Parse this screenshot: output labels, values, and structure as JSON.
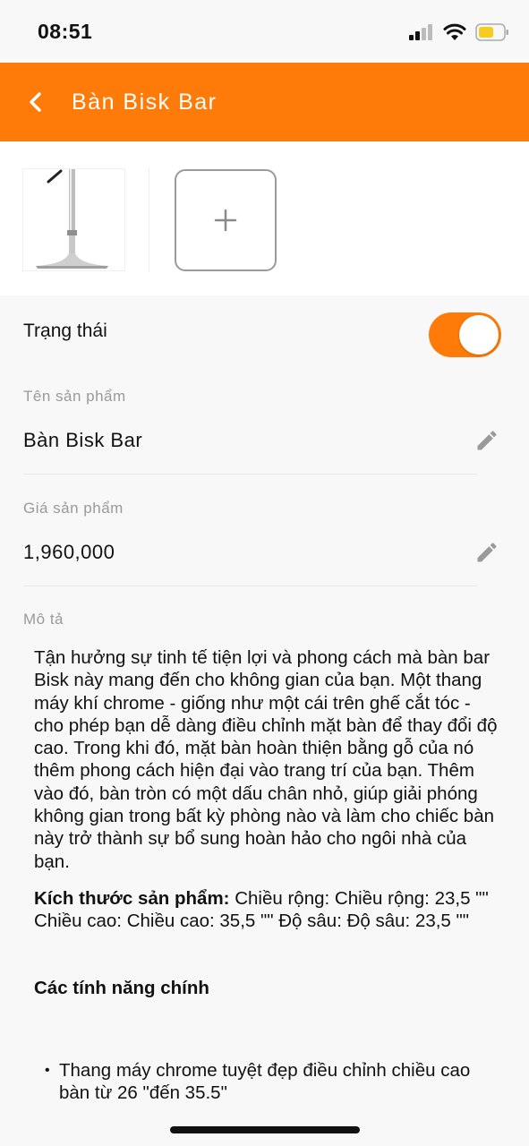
{
  "status_bar": {
    "time": "08:51",
    "battery_color": "#f5cc1f"
  },
  "header": {
    "title": "Bàn Bisk Bar",
    "background": "#ff7b09"
  },
  "images": {
    "thumb_icon": "bar-stool-image",
    "add_icon": "plus-icon"
  },
  "status_row": {
    "label": "Trạng thái",
    "enabled": true,
    "accent": "#ff7b09"
  },
  "name_field": {
    "label": "Tên sản phẩm",
    "value": "Bàn Bisk Bar"
  },
  "price_field": {
    "label": "Giá sản phẩm",
    "value": "1,960,000"
  },
  "description": {
    "label": "Mô tả",
    "paragraph": "Tận hưởng sự tinh tế tiện lợi và phong cách mà bàn bar Bisk này mang đến cho không gian của bạn. Một thang máy khí chrome - giống như một cái trên ghế cắt tóc - cho phép bạn dễ dàng điều chỉnh mặt bàn để thay đổi độ cao. Trong khi đó, mặt bàn hoàn thiện bằng gỗ của nó thêm phong cách hiện đại vào trang trí của bạn. Thêm vào đó, bàn tròn có một dấu chân nhỏ, giúp giải phóng không gian trong bất kỳ phòng nào và làm cho chiếc bàn này trở thành sự bổ sung hoàn hảo cho ngôi nhà của bạn.",
    "dimensions_label": "Kích thước sản phẩm:",
    "dimensions_text": " Chiều rộng: Chiều rộng: 23,5 \"\" Chiều cao: Chiều cao: 35,5 \"\" Độ sâu: Độ sâu: 23,5 \"\"",
    "features_heading": "Các tính năng chính",
    "features": [
      "Thang máy chrome tuyệt đẹp điều chỉnh chiều cao bàn từ 26 \"đến 35,5\""
    ]
  }
}
